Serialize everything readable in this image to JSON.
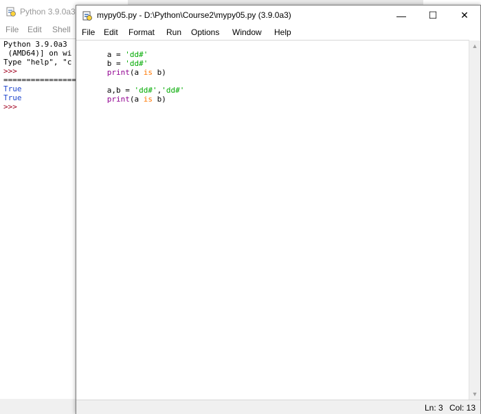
{
  "shell": {
    "title": "Python 3.9.0a3",
    "menu": [
      "File",
      "Edit",
      "Shell"
    ],
    "lines": [
      {
        "text": "Python 3.9.0a3",
        "cls": ""
      },
      {
        "text": " (AMD64)] on wi",
        "cls": ""
      },
      {
        "text": "Type \"help\", \"c",
        "cls": ""
      },
      {
        "text": ">>>",
        "cls": "maroon"
      },
      {
        "text": "================",
        "cls": ""
      },
      {
        "text": "True",
        "cls": "blue"
      },
      {
        "text": "True",
        "cls": "blue"
      },
      {
        "text": ">>>",
        "cls": "maroon"
      }
    ]
  },
  "editor": {
    "title": "mypy05.py - D:\\Python\\Course2\\mypy05.py (3.9.0a3)",
    "buttons": {
      "minimize": "—",
      "maximize": "☐",
      "close": "✕"
    },
    "menu": [
      "File",
      "Edit",
      "Format",
      "Run",
      "Options",
      "Window",
      "Help"
    ],
    "code": [
      [
        {
          "t": "a = ",
          "c": ""
        },
        {
          "t": "'dd#'",
          "c": "str"
        }
      ],
      [
        {
          "t": "b = ",
          "c": ""
        },
        {
          "t": "'dd#'",
          "c": "str"
        }
      ],
      [
        {
          "t": "print",
          "c": "kw-builtin"
        },
        {
          "t": "(a ",
          "c": ""
        },
        {
          "t": "is",
          "c": "kw"
        },
        {
          "t": " b)",
          "c": ""
        }
      ],
      [],
      [
        {
          "t": "a,b = ",
          "c": ""
        },
        {
          "t": "'dd#'",
          "c": "str"
        },
        {
          "t": ",",
          "c": ""
        },
        {
          "t": "'dd#'",
          "c": "str"
        }
      ],
      [
        {
          "t": "print",
          "c": "kw-builtin"
        },
        {
          "t": "(a ",
          "c": ""
        },
        {
          "t": "is",
          "c": "kw"
        },
        {
          "t": " b)",
          "c": ""
        }
      ]
    ],
    "status": {
      "ln": "Ln: 3",
      "col": "Col: 13"
    }
  },
  "colors": {
    "string": "#00aa00",
    "builtin": "#900090",
    "keyword": "#ff7700",
    "output": "#1d44cc",
    "prompt": "#a0001e"
  },
  "icons": {
    "app": "python-idle-icon",
    "scroll_up": "chevron-up-icon",
    "scroll_down": "chevron-down-icon"
  }
}
